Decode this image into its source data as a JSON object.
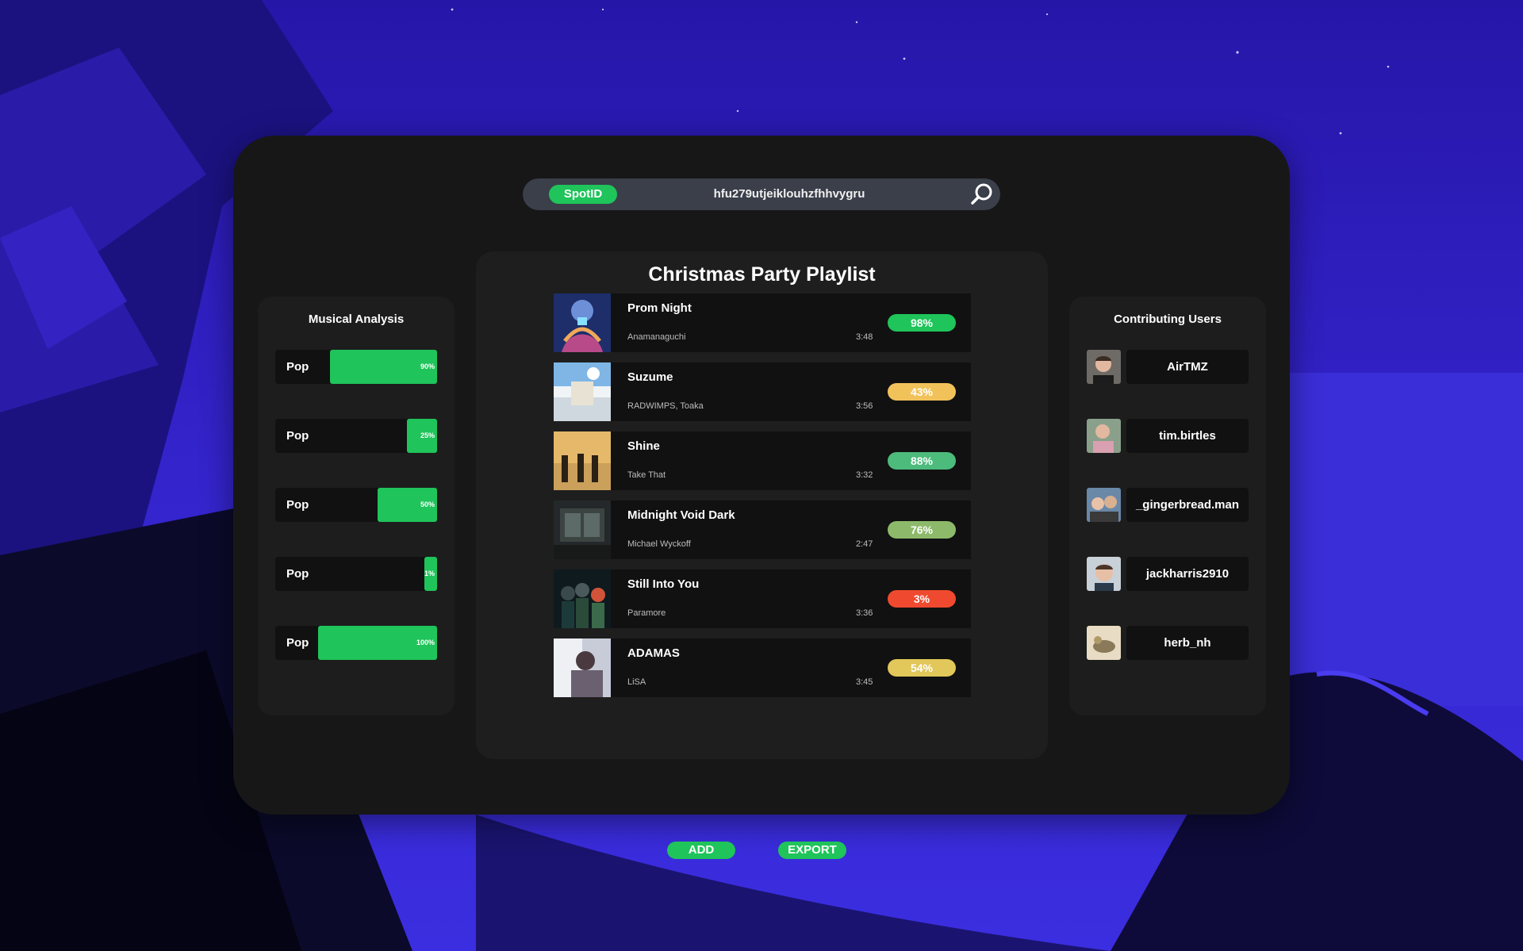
{
  "search": {
    "chip_label": "SpotID",
    "query": "hfu279utjeiklouhzfhhvygru",
    "icon": "search-icon"
  },
  "analysis": {
    "title": "Musical Analysis",
    "rows": [
      {
        "label": "Pop",
        "value": 90,
        "pct_label": "90%"
      },
      {
        "label": "Pop",
        "value": 25,
        "pct_label": "25%"
      },
      {
        "label": "Pop",
        "value": 50,
        "pct_label": "50%"
      },
      {
        "label": "Pop",
        "value": 1,
        "pct_label": "1%"
      },
      {
        "label": "Pop",
        "value": 100,
        "pct_label": "100%"
      }
    ]
  },
  "playlist": {
    "title": "Christmas Party Playlist",
    "tracks": [
      {
        "title": "Prom Night",
        "artist": "Anamanaguchi",
        "duration": "3:48",
        "score": "98%",
        "score_color": "#1fc45a"
      },
      {
        "title": "Suzume",
        "artist": "RADWIMPS, Toaka",
        "duration": "3:56",
        "score": "43%",
        "score_color": "#f2c25a"
      },
      {
        "title": "Shine",
        "artist": "Take That",
        "duration": "3:32",
        "score": "88%",
        "score_color": "#4cbb7c"
      },
      {
        "title": "Midnight Void Dark",
        "artist": "Michael Wyckoff",
        "duration": "2:47",
        "score": "76%",
        "score_color": "#8dba6a"
      },
      {
        "title": "Still Into You",
        "artist": "Paramore",
        "duration": "3:36",
        "score": "3%",
        "score_color": "#ef4a2f"
      },
      {
        "title": "ADAMAS",
        "artist": "LiSA",
        "duration": "3:45",
        "score": "54%",
        "score_color": "#e2c75a"
      }
    ],
    "add_label": "ADD",
    "export_label": "EXPORT"
  },
  "users": {
    "title": "Contributing Users",
    "list": [
      {
        "name": "AirTMZ"
      },
      {
        "name": "tim.birtles"
      },
      {
        "name": "_gingerbread.man"
      },
      {
        "name": "jackharris2910"
      },
      {
        "name": "herb_nh"
      }
    ]
  },
  "colors": {
    "accent": "#1fc45a",
    "app_bg": "#171717",
    "panel_bg": "#1d1d1d"
  }
}
